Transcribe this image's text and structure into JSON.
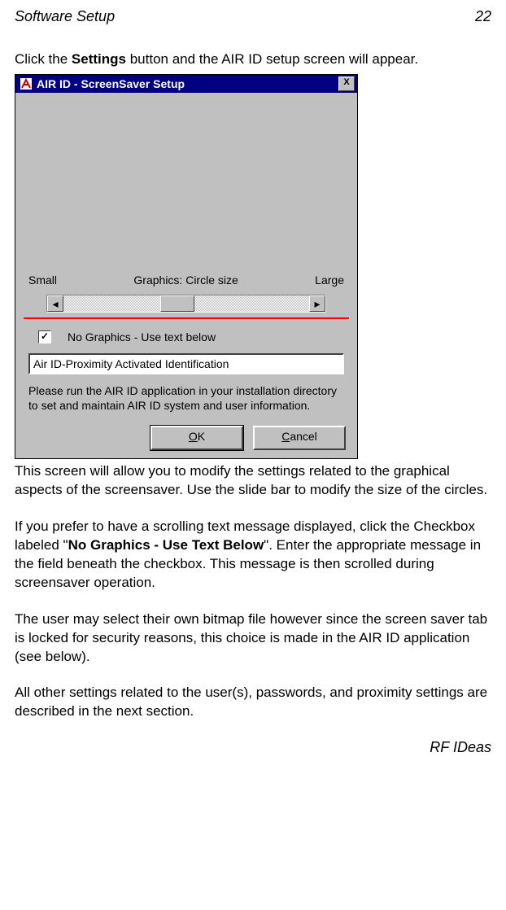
{
  "header": {
    "section": "Software Setup",
    "page": "22"
  },
  "intro": {
    "pre": "Click the ",
    "bold": "Settings",
    "post": " button and the AIR ID setup screen will appear."
  },
  "dialog": {
    "title": "AIR ID - ScreenSaver Setup",
    "close_x": "X",
    "slider": {
      "small": "Small",
      "label": "Graphics: Circle size",
      "large": "Large"
    },
    "checkbox": {
      "mark": "✓",
      "label": "No Graphics - Use text below"
    },
    "textfield": "Air ID-Proximity Activated Identification",
    "help": "Please run the AIR ID application  in your installation directory to set and maintain AIR ID system and user information.",
    "ok_u": "O",
    "ok_rest": "K",
    "cancel_u": "C",
    "cancel_rest": "ancel",
    "arrow_left": "◂",
    "arrow_right": "▸"
  },
  "paras": {
    "p1": "This screen will allow you to modify the settings related to the graphical aspects of the screensaver.  Use the slide bar to modify the size of the circles.",
    "p2_pre": "If you prefer to have a scrolling text message displayed, click the Checkbox labeled \"",
    "p2_bold": "No Graphics - Use Text Below",
    "p2_post": "\".  Enter the appropriate message in the field beneath the checkbox.  This message is then scrolled during screensaver operation.",
    "p3": "The user may select their own bitmap file however since the screen saver tab is locked for security reasons, this choice is made in the AIR ID application (see below).",
    "p4": "All other settings related to the user(s), passwords, and proximity settings are described in the next section."
  },
  "footer": "RF IDeas"
}
